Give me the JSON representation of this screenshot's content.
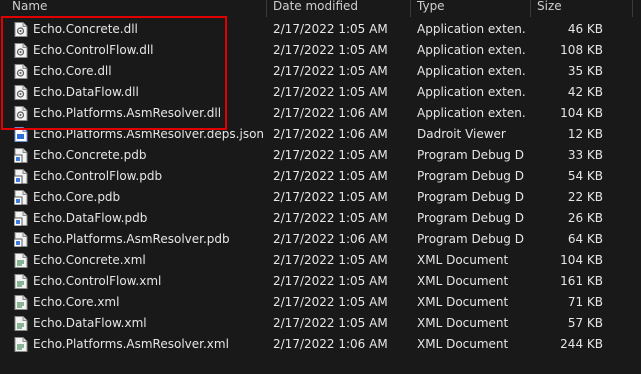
{
  "columns": {
    "name": "Name",
    "date": "Date modified",
    "type": "Type",
    "size": "Size"
  },
  "files": [
    {
      "name": "Echo.Concrete.dll",
      "date": "2/17/2022 1:05 AM",
      "type": "Application exten...",
      "size": "46 KB",
      "icon": "dll-file-icon"
    },
    {
      "name": "Echo.ControlFlow.dll",
      "date": "2/17/2022 1:05 AM",
      "type": "Application exten...",
      "size": "108 KB",
      "icon": "dll-file-icon"
    },
    {
      "name": "Echo.Core.dll",
      "date": "2/17/2022 1:05 AM",
      "type": "Application exten...",
      "size": "35 KB",
      "icon": "dll-file-icon"
    },
    {
      "name": "Echo.DataFlow.dll",
      "date": "2/17/2022 1:05 AM",
      "type": "Application exten...",
      "size": "42 KB",
      "icon": "dll-file-icon"
    },
    {
      "name": "Echo.Platforms.AsmResolver.dll",
      "date": "2/17/2022 1:06 AM",
      "type": "Application exten...",
      "size": "104 KB",
      "icon": "dll-file-icon"
    },
    {
      "name": "Echo.Platforms.AsmResolver.deps.json",
      "date": "2/17/2022 1:06 AM",
      "type": "Dadroit Viewer",
      "size": "12 KB",
      "icon": "json-file-icon"
    },
    {
      "name": "Echo.Concrete.pdb",
      "date": "2/17/2022 1:05 AM",
      "type": "Program Debug D...",
      "size": "33 KB",
      "icon": "pdb-file-icon"
    },
    {
      "name": "Echo.ControlFlow.pdb",
      "date": "2/17/2022 1:05 AM",
      "type": "Program Debug D...",
      "size": "54 KB",
      "icon": "pdb-file-icon"
    },
    {
      "name": "Echo.Core.pdb",
      "date": "2/17/2022 1:05 AM",
      "type": "Program Debug D...",
      "size": "22 KB",
      "icon": "pdb-file-icon"
    },
    {
      "name": "Echo.DataFlow.pdb",
      "date": "2/17/2022 1:05 AM",
      "type": "Program Debug D...",
      "size": "26 KB",
      "icon": "pdb-file-icon"
    },
    {
      "name": "Echo.Platforms.AsmResolver.pdb",
      "date": "2/17/2022 1:06 AM",
      "type": "Program Debug D...",
      "size": "64 KB",
      "icon": "pdb-file-icon"
    },
    {
      "name": "Echo.Concrete.xml",
      "date": "2/17/2022 1:05 AM",
      "type": "XML Document",
      "size": "104 KB",
      "icon": "xml-file-icon"
    },
    {
      "name": "Echo.ControlFlow.xml",
      "date": "2/17/2022 1:05 AM",
      "type": "XML Document",
      "size": "161 KB",
      "icon": "xml-file-icon"
    },
    {
      "name": "Echo.Core.xml",
      "date": "2/17/2022 1:05 AM",
      "type": "XML Document",
      "size": "71 KB",
      "icon": "xml-file-icon"
    },
    {
      "name": "Echo.DataFlow.xml",
      "date": "2/17/2022 1:05 AM",
      "type": "XML Document",
      "size": "57 KB",
      "icon": "xml-file-icon"
    },
    {
      "name": "Echo.Platforms.AsmResolver.xml",
      "date": "2/17/2022 1:06 AM",
      "type": "XML Document",
      "size": "244 KB",
      "icon": "xml-file-icon"
    }
  ],
  "colors": {
    "background": "#191919",
    "text": "#e6e6e6",
    "highlight_border": "#e00000"
  }
}
